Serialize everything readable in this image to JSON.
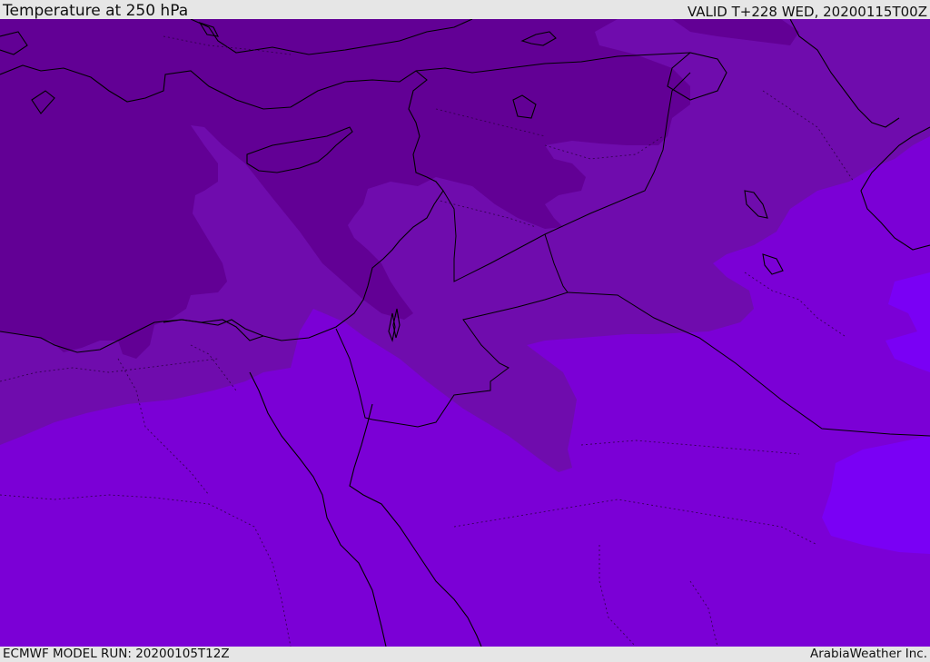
{
  "header": {
    "title": "Temperature at 250 hPa",
    "valid": "VALID T+228 WED, 20200115T00Z"
  },
  "footer": {
    "model_run": "ECMWF MODEL RUN: 20200105T12Z",
    "provider": "ArabiaWeather Inc."
  },
  "map": {
    "field": "temperature_250hPa",
    "colors": {
      "band_coldest": "#620095",
      "band_cold": "#6f0cad",
      "band_mid": "#7b00d6",
      "band_warm": "#7a00f5",
      "coastline": "#000000",
      "border": "#000000"
    }
  }
}
